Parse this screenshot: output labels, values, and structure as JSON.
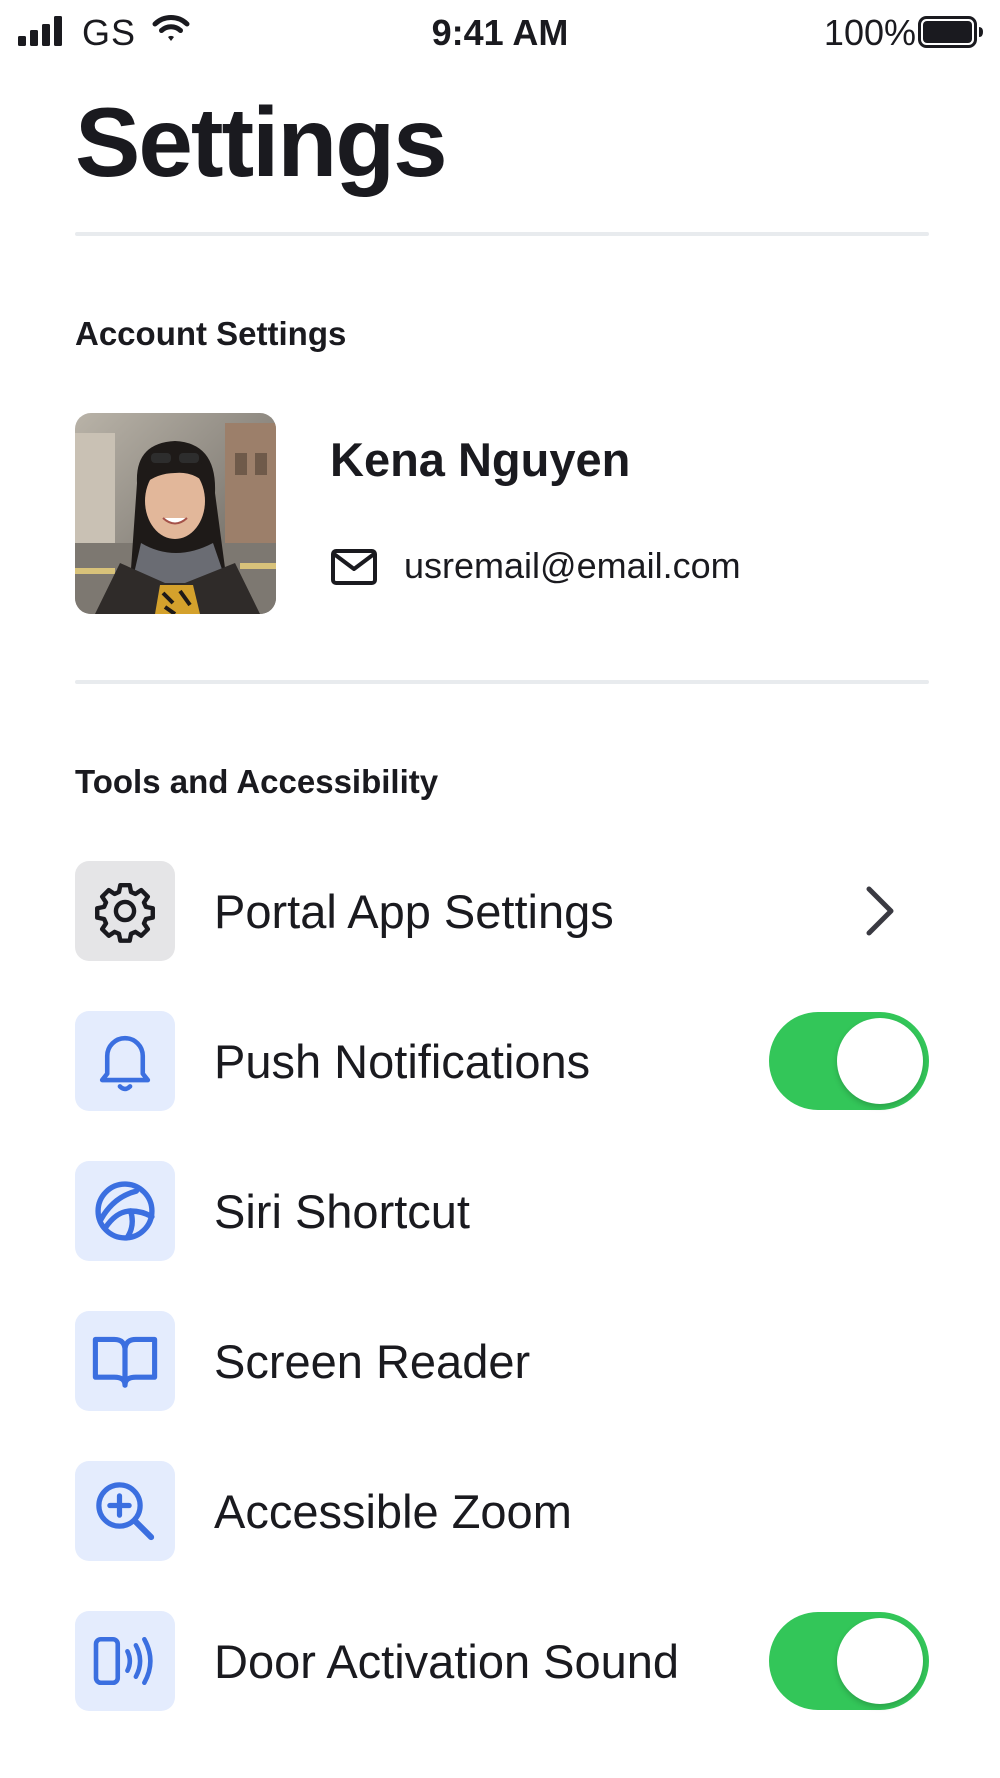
{
  "status_bar": {
    "carrier": "GS",
    "time": "9:41 AM",
    "battery_percent": "100%",
    "battery_level": 1.0
  },
  "page": {
    "title": "Settings"
  },
  "account": {
    "heading": "Account Settings",
    "name": "Kena Nguyen",
    "email": "usremail@email.com"
  },
  "tools": {
    "heading": "Tools and Accessibility",
    "items": [
      {
        "label": "Portal App Settings",
        "icon": "gear-icon",
        "control": "chevron"
      },
      {
        "label": "Push Notifications",
        "icon": "bell-icon",
        "control": "toggle",
        "on": true
      },
      {
        "label": "Siri Shortcut",
        "icon": "siri-icon",
        "control": "none"
      },
      {
        "label": "Screen Reader",
        "icon": "book-icon",
        "control": "none"
      },
      {
        "label": "Accessible Zoom",
        "icon": "zoom-in-icon",
        "control": "none"
      },
      {
        "label": "Door Activation Sound",
        "icon": "sound-icon",
        "control": "toggle",
        "on": true
      }
    ]
  },
  "colors": {
    "accent": "#3b6fe0",
    "icon_tile": "#e4ecfd",
    "toggle_on": "#33c659",
    "text": "#1a1a1f",
    "divider": "#e8ebee"
  }
}
